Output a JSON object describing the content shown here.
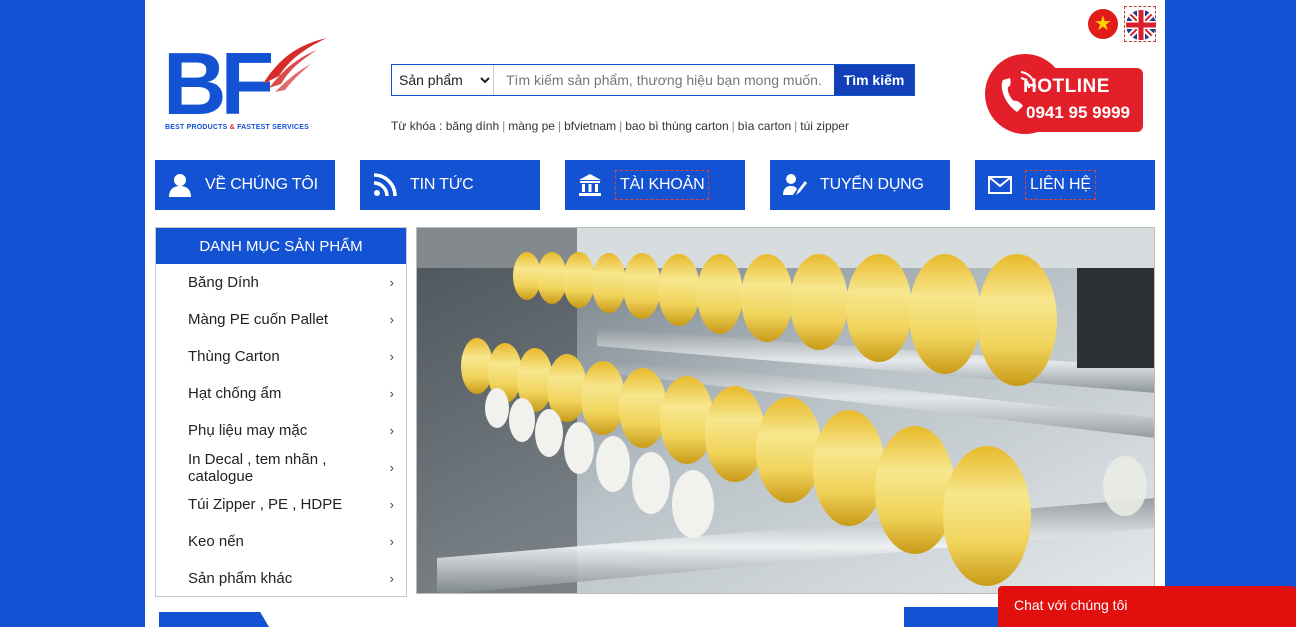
{
  "logo": {
    "letters": "BF",
    "tagline_part1": "BEST PRODUCTS",
    "tagline_amp": "&",
    "tagline_part2": "FASTEST SERVICES"
  },
  "search": {
    "category_selected": "Sản phẩm",
    "placeholder": "Tìm kiếm sản phẩm, thương hiệu bạn mong muốn...",
    "button_label": "Tìm kiếm"
  },
  "keywords": {
    "prefix": "Từ khóa :",
    "items": [
      "băng dính",
      "màng pe",
      "bfvietnam",
      "bao bì thùng carton",
      "bìa carton",
      "túi zipper"
    ]
  },
  "hotline": {
    "label": "HOTLINE",
    "number": "0941 95 9999"
  },
  "nav": [
    {
      "label": "VỀ CHÚNG TÔI",
      "icon": "user-icon"
    },
    {
      "label": "TIN TỨC",
      "icon": "rss-icon"
    },
    {
      "label": "TÀI KHOẢN",
      "icon": "bank-icon"
    },
    {
      "label": "TUYỂN DỤNG",
      "icon": "recruit-icon"
    },
    {
      "label": "LIÊN HỆ",
      "icon": "mail-icon"
    }
  ],
  "sidebar": {
    "title": "DANH MỤC SẢN PHẨM",
    "items": [
      "Băng Dính",
      "Màng PE cuốn Pallet",
      "Thùng Carton",
      "Hạt chống ẩm",
      "Phụ liệu may mặc",
      "In Decal , tem nhãn , catalogue",
      "Túi Zipper , PE , HDPE",
      "Keo nến",
      "Sản phẩm khác"
    ],
    "chevron": "›"
  },
  "chat": {
    "label": "Chat với chúng tôi"
  },
  "colors": {
    "brand_blue": "#1352d3",
    "hotline_red": "#e3202a",
    "chat_red": "#e20f0f"
  }
}
